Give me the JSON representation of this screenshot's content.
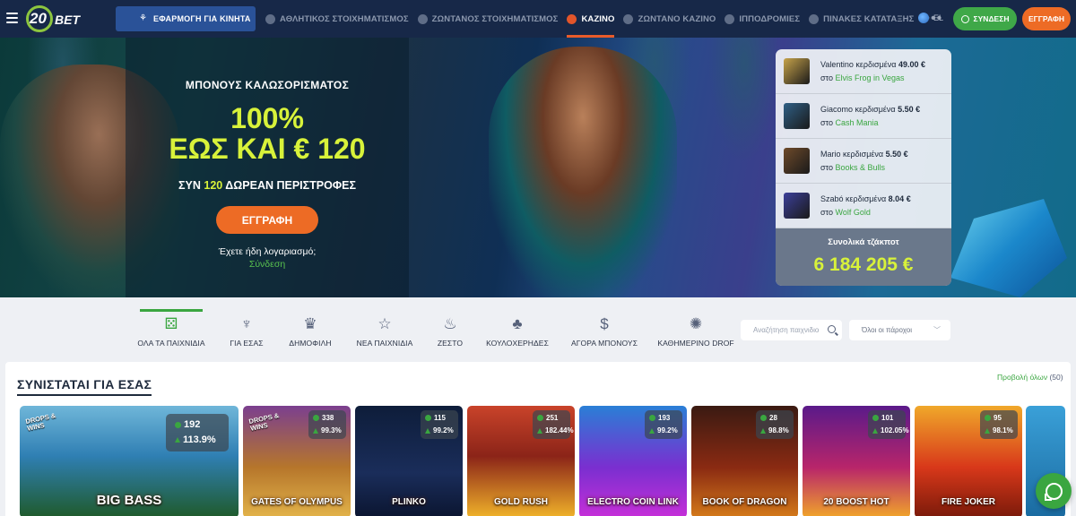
{
  "header": {
    "logo_number": "20",
    "logo_text": "BET",
    "app_button_label": "ΕΦΑΡΜΟΓΗ ΓΙΑ ΚΙΝΗΤΑ",
    "nav": [
      {
        "label": "ΑΘΛΗΤΙΚΟΣ ΣΤΟΙΧΗΜΑΤΙΣΜΟΣ",
        "icon": "soccer-ball-icon",
        "active": false
      },
      {
        "label": "ΖΩΝΤΑΝΟΣ ΣΤΟΙΧΗΜΑΤΙΣΜΟΣ",
        "icon": "flame-icon",
        "active": false
      },
      {
        "label": "ΚΑΖΙΝΟ",
        "icon": "roulette-icon",
        "active": true
      },
      {
        "label": "ΖΩΝΤΑΝΟ ΚΑΖΙΝΟ",
        "icon": "live-casino-icon",
        "active": false
      },
      {
        "label": "ΙΠΠΟΔΡΟΜΙΕΣ",
        "icon": "horse-icon",
        "active": false
      },
      {
        "label": "ΠΙΝΑΚΕΣ ΚΑΤΑΤΑΞΗΣ",
        "icon": "trophy-icon",
        "active": false
      }
    ],
    "more_label": "•••",
    "language": "EL",
    "login_label": "ΣΥΝΔΕΣΗ",
    "register_label": "ΕΓΓΡΑΦΗ"
  },
  "hero": {
    "subtitle": "ΜΠΟΝΟΥΣ ΚΑΛΩΣΟΡΙΣΜΑΤΟΣ",
    "percent": "100%",
    "upto_prefix": "ΕΩΣ ΚΑΙ",
    "upto_amount": "€ 120",
    "spins_prefix": "ΣΥΝ",
    "spins_count": "120",
    "spins_suffix": "ΔΩΡΕΑΝ ΠΕΡΙΣΤΡΟΦΕΣ",
    "cta_label": "ΕΓΓΡΑΦΗ",
    "have_account": "Έχετε ήδη λογαριασμό;",
    "signin_link": "Σύνδεση"
  },
  "winners": {
    "items": [
      {
        "name": "Valentino",
        "verb": "κερδισμένα",
        "amount": "49.00 €",
        "prep": "στο",
        "game": "Elvis Frog in Vegas",
        "color": "#c7a34a"
      },
      {
        "name": "Giacomo",
        "verb": "κερδισμένα",
        "amount": "5.50 €",
        "prep": "στο",
        "game": "Cash Mania",
        "color": "#2f5f86"
      },
      {
        "name": "Mario",
        "verb": "κερδισμένα",
        "amount": "5.50 €",
        "prep": "στο",
        "game": "Books & Bulls",
        "color": "#6e4a2a"
      },
      {
        "name": "Szabó",
        "verb": "κερδισμένα",
        "amount": "8.04 €",
        "prep": "στο",
        "game": "Wolf Gold",
        "color": "#3b3f9a"
      }
    ],
    "jackpot_label": "Συνολικά τζάκποτ",
    "jackpot_value": "6 184 205 €"
  },
  "categories": [
    {
      "label": "ΟΛΑ ΤΑ ΠΑΙΧΝΙΔΙΑ",
      "icon": "dice-icon",
      "glyph": "⚄",
      "active": true
    },
    {
      "label": "ΓΙΑ ΕΣΑΣ",
      "icon": "for-you-icon",
      "glyph": "♆",
      "active": false
    },
    {
      "label": "ΔΗΜΟΦΙΛΗ",
      "icon": "crown-icon",
      "glyph": "♛",
      "active": false
    },
    {
      "label": "ΝΕΑ ΠΑΙΧΝΙΔΙΑ",
      "icon": "star-icon",
      "glyph": "☆",
      "active": false
    },
    {
      "label": "ΖΕΣΤΟ",
      "icon": "chili-icon",
      "glyph": "♨",
      "active": false
    },
    {
      "label": "ΚΟΥΛΟΧΕΡΗΔΕΣ",
      "icon": "cherries-icon",
      "glyph": "♣",
      "active": false
    },
    {
      "label": "ΑΓΟΡΑ ΜΠΟΝΟΥΣ",
      "icon": "money-bag-icon",
      "glyph": "$",
      "active": false
    },
    {
      "label": "ΚΑΘΗΜΕΡΙΝΟ DROF",
      "icon": "daily-drop-icon",
      "glyph": "✺",
      "active": false
    }
  ],
  "search": {
    "placeholder": "Αναζήτηση παιχνιδιο"
  },
  "providers": {
    "value": "Όλοι οι πάροχοι"
  },
  "recommended": {
    "title": "ΣΥΝΙΣΤΑΤΑΙ ΓΙΑ ΕΣΑΣ",
    "view_all": "Προβολή όλων",
    "count": "(50)",
    "games": [
      {
        "title": "BIG BASS",
        "players": "192",
        "rtp": "113.9%",
        "drops": "DROPS & WINS",
        "bg": "linear-gradient(180deg,#6fb6d9 0%,#2f7fb3 45%,#1f5a2a 100%)"
      },
      {
        "title": "GATES OF OLYMPUS",
        "players": "338",
        "rtp": "99.3%",
        "drops": "DROPS & WINS",
        "bg": "linear-gradient(180deg,#7b3f8f 0%,#b6762b 55%,#e2b34a 100%)"
      },
      {
        "title": "PLINKO",
        "players": "115",
        "rtp": "99.2%",
        "drops": "",
        "bg": "linear-gradient(180deg,#0e1d3a 0%,#1a2d5a 60%,#0b1530 100%)"
      },
      {
        "title": "GOLD RUSH",
        "players": "251",
        "rtp": "182.44%",
        "drops": "",
        "bg": "linear-gradient(180deg,#c9432a 0%,#8b2418 45%,#f0b32a 100%)"
      },
      {
        "title": "ELECTRO COIN LINK",
        "players": "193",
        "rtp": "99.2%",
        "drops": "",
        "bg": "linear-gradient(180deg,#2a7fd6 0%,#7a2fd0 55%,#c62fd8 100%)"
      },
      {
        "title": "BOOK OF DRAGON",
        "players": "28",
        "rtp": "98.8%",
        "drops": "",
        "bg": "linear-gradient(180deg,#3a1a12 0%,#8a2a12 55%,#d47a1a 100%)"
      },
      {
        "title": "20 BOOST HOT",
        "players": "101",
        "rtp": "102.05%",
        "drops": "",
        "bg": "linear-gradient(180deg,#5a1a8a 0%,#b8256a 55%,#f0a52a 100%)"
      },
      {
        "title": "FIRE JOKER",
        "players": "95",
        "rtp": "98.1%",
        "drops": "",
        "bg": "linear-gradient(180deg,#f0a82a 0%,#d8381a 55%,#7a1a0a 100%)"
      },
      {
        "title": "",
        "players": "",
        "rtp": "",
        "drops": "",
        "bg": "linear-gradient(180deg,#3aa0d8 0%,#1a6aa0 100%)"
      }
    ]
  }
}
